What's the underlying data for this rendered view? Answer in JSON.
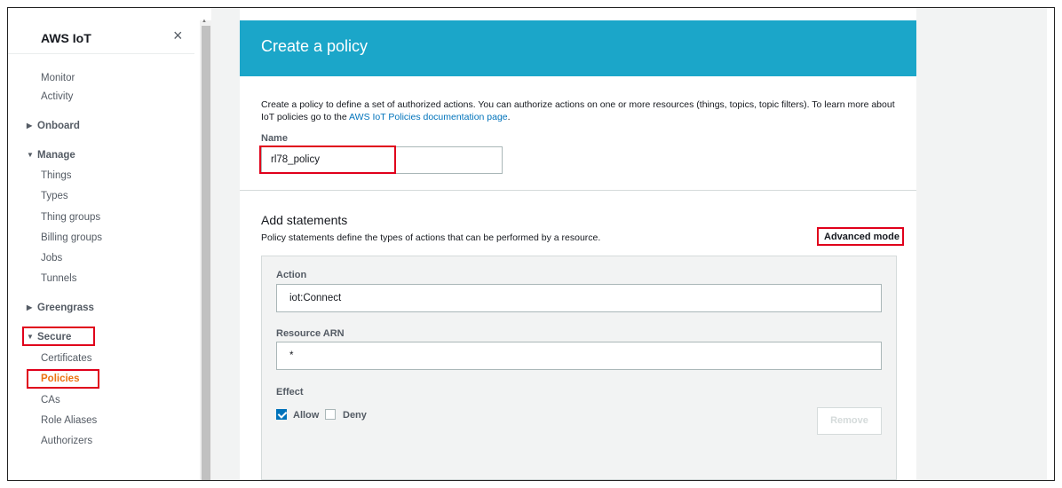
{
  "sidebar": {
    "title": "AWS IoT",
    "close_icon": "×",
    "items": [
      {
        "label": "Monitor",
        "type": "item"
      },
      {
        "label": "Activity",
        "type": "item"
      },
      {
        "label": "Onboard",
        "type": "section",
        "arrow": "▶"
      },
      {
        "label": "Manage",
        "type": "section",
        "arrow": "▼"
      },
      {
        "label": "Things",
        "type": "item"
      },
      {
        "label": "Types",
        "type": "item"
      },
      {
        "label": "Thing groups",
        "type": "item"
      },
      {
        "label": "Billing groups",
        "type": "item"
      },
      {
        "label": "Jobs",
        "type": "item"
      },
      {
        "label": "Tunnels",
        "type": "item"
      },
      {
        "label": "Greengrass",
        "type": "section",
        "arrow": "▶"
      },
      {
        "label": "Secure",
        "type": "section",
        "arrow": "▼"
      },
      {
        "label": "Certificates",
        "type": "item"
      },
      {
        "label": "Policies",
        "type": "item",
        "active": true
      },
      {
        "label": "CAs",
        "type": "item"
      },
      {
        "label": "Role Aliases",
        "type": "item"
      },
      {
        "label": "Authorizers",
        "type": "item"
      }
    ]
  },
  "page": {
    "title": "Create a policy",
    "description": "Create a policy to define a set of authorized actions. You can authorize actions on one or more resources (things, topics, topic filters). To learn more about IoT policies go to the ",
    "description_link": "AWS IoT Policies documentation page",
    "description_end": ".",
    "name_label": "Name",
    "name_value": "rl78_policy"
  },
  "statements": {
    "heading": "Add statements",
    "subtext": "Policy statements define the types of actions that can be performed by a resource.",
    "advanced_mode": "Advanced mode",
    "action_label": "Action",
    "action_value": "iot:Connect",
    "resource_label": "Resource ARN",
    "resource_value": "*",
    "effect_label": "Effect",
    "allow_label": "Allow",
    "allow_checked": true,
    "deny_label": "Deny",
    "deny_checked": false,
    "remove_label": "Remove"
  },
  "colors": {
    "banner": "#1ba6c9",
    "link": "#0073bb",
    "active": "#ec7211",
    "highlight": "#e0001b"
  }
}
